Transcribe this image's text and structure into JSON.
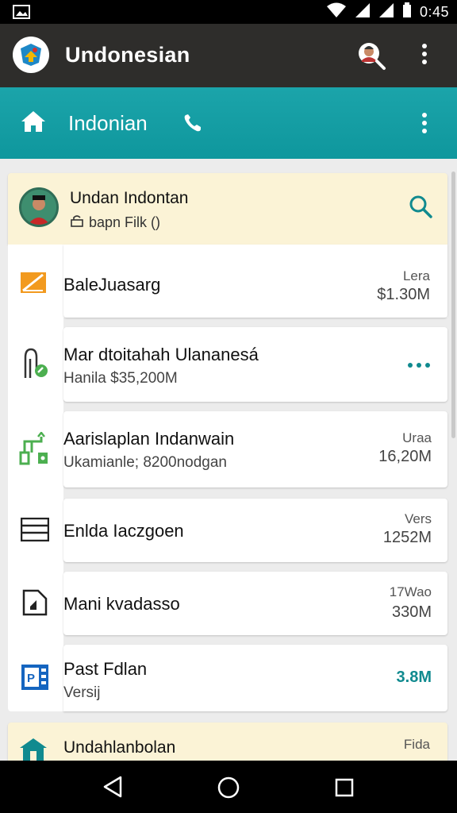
{
  "status_bar": {
    "time": "0:45"
  },
  "app_bar": {
    "title": "Undonesian"
  },
  "toolbar": {
    "label": "Indonian"
  },
  "profile": {
    "name": "Undan Indontan",
    "subline": "bapn Filk ()"
  },
  "items": [
    {
      "title": "BaleJuasarg",
      "subtitle": "",
      "meta_top": "Lera",
      "meta_value": "$1.30M",
      "icon": "chart-slash-icon",
      "color": "#f29a1f"
    },
    {
      "title": "Mar dtoitahah Ulananesá",
      "subtitle": "Hanila $35,200M",
      "meta_top": "",
      "meta_value": "",
      "icon": "plug-icon",
      "color": "#4caf50"
    },
    {
      "title": "Aarislaplan Indanwain",
      "subtitle": "Ukamianle; 8200nodgan",
      "meta_top": "Uraa",
      "meta_value": "16,20M",
      "icon": "network-icon",
      "color": "#4caf50"
    },
    {
      "title": "Enlda Iaczgoen",
      "subtitle": "",
      "meta_top": "Vers",
      "meta_value": "1252M",
      "icon": "list-icon",
      "color": "#222222"
    },
    {
      "title": "Mani kvadasso",
      "subtitle": "",
      "meta_top": "17Wao",
      "meta_value": "330M",
      "icon": "folder-icon",
      "color": "#222222"
    },
    {
      "title": "Past Fdlan",
      "subtitle": "Versij",
      "meta_top": "",
      "meta_value": "3.8M",
      "icon": "document-icon",
      "color": "#1565c0",
      "meta_color": "#108a8f"
    }
  ],
  "footer_item": {
    "title": "Undahlanbolan",
    "meta_top": "Fida",
    "icon": "house-icon"
  },
  "colors": {
    "appbar": "#2e2d2b",
    "toolbar": "#1ba4aa",
    "profile_bg": "#fbf3d6",
    "accent": "#108a8f"
  }
}
